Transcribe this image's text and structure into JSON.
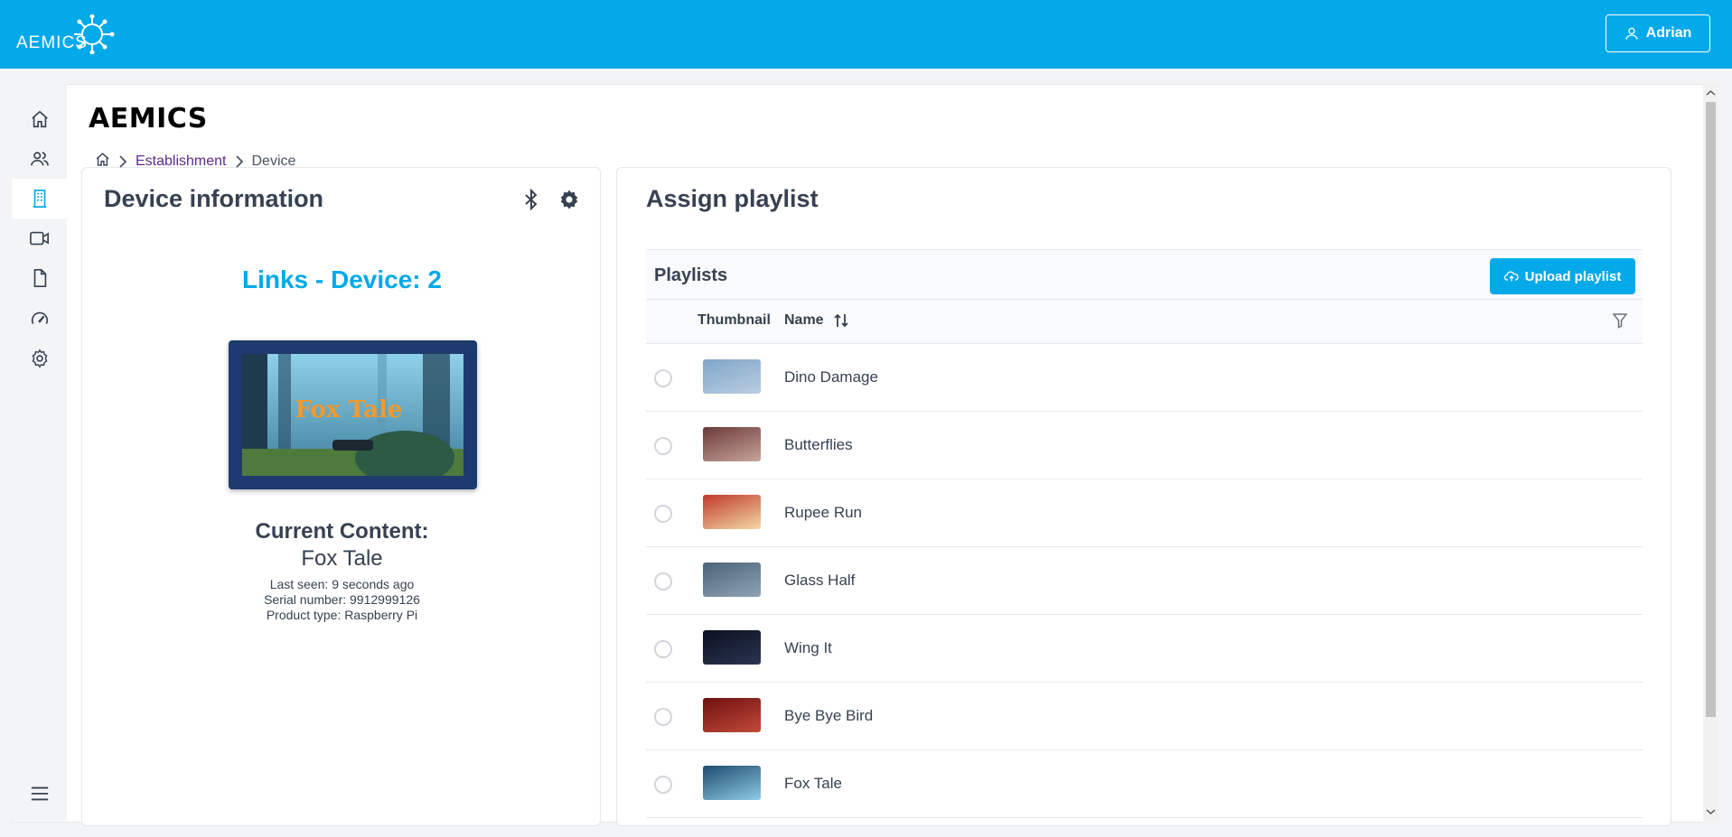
{
  "app": {
    "logo_text": "AEMICS",
    "brand": "AEMICS"
  },
  "header": {
    "user_name": "Adrian"
  },
  "sidebar": {
    "items": [
      {
        "icon": "home-icon",
        "active": false
      },
      {
        "icon": "users-icon",
        "active": false
      },
      {
        "icon": "building-icon",
        "active": true
      },
      {
        "icon": "video-icon",
        "active": false
      },
      {
        "icon": "file-icon",
        "active": false
      },
      {
        "icon": "speedometer-icon",
        "active": false
      },
      {
        "icon": "gear-icon",
        "active": false
      }
    ],
    "menu_icon": "hamburger-menu-icon"
  },
  "breadcrumb": {
    "items": [
      "Establishment",
      "Device"
    ]
  },
  "device_info": {
    "title": "Device information",
    "device_name": "Links - Device: 2",
    "current_content_label": "Current Content:",
    "current_content_value": "Fox Tale",
    "screen_caption": "Fox Tale",
    "last_seen": "Last seen: 9 seconds ago",
    "serial_number": "Serial number: 9912999126",
    "product_type": "Product type: Raspberry Pi"
  },
  "assign_playlist": {
    "title": "Assign playlist",
    "playlists_label": "Playlists",
    "upload_label": "Upload playlist",
    "columns": {
      "thumbnail": "Thumbnail",
      "name": "Name"
    },
    "rows": [
      {
        "name": "Dino Damage",
        "colors": [
          "#7fa6c9",
          "#b9cde0"
        ]
      },
      {
        "name": "Butterflies",
        "colors": [
          "#6b3a3a",
          "#c7a49a"
        ]
      },
      {
        "name": "Rupee Run",
        "colors": [
          "#c0392b",
          "#f3d9a4"
        ]
      },
      {
        "name": "Glass Half",
        "colors": [
          "#4b6378",
          "#8ea3b5"
        ]
      },
      {
        "name": "Wing It",
        "colors": [
          "#0b1020",
          "#2b3550"
        ]
      },
      {
        "name": "Bye Bye Bird",
        "colors": [
          "#6e1010",
          "#c24a3a"
        ]
      },
      {
        "name": "Fox Tale",
        "colors": [
          "#1f4b6e",
          "#8ccbe6"
        ]
      }
    ]
  }
}
